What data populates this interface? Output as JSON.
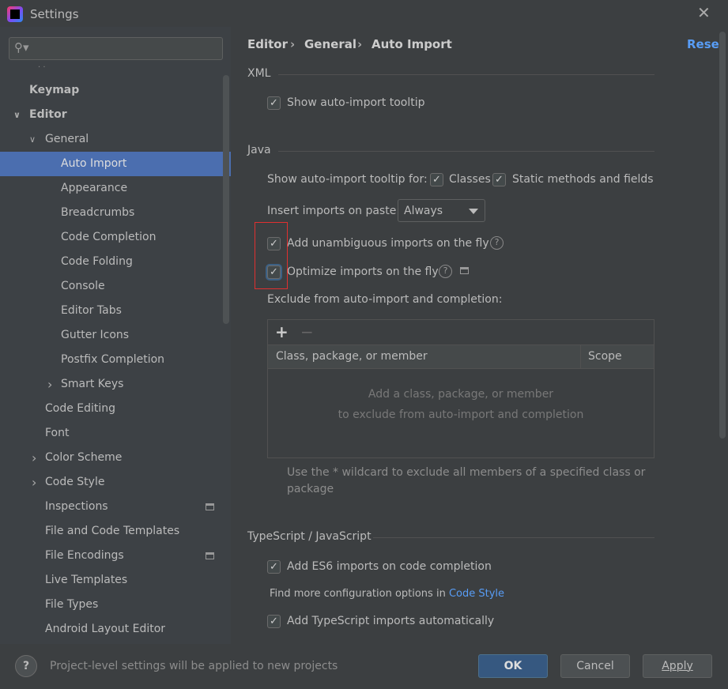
{
  "window": {
    "title": "Settings",
    "close": "✕"
  },
  "search": {
    "icon": "search-icon",
    "glyph": "⚲▾",
    "value": ""
  },
  "tree": [
    {
      "label": "Keymap",
      "level": 0,
      "bold": true
    },
    {
      "label": "Editor",
      "level": 0,
      "bold": true,
      "expanded": true
    },
    {
      "label": "General",
      "level": 1,
      "expanded": true
    },
    {
      "label": "Auto Import",
      "level": 2,
      "selected": true
    },
    {
      "label": "Appearance",
      "level": 2
    },
    {
      "label": "Breadcrumbs",
      "level": 2
    },
    {
      "label": "Code Completion",
      "level": 2
    },
    {
      "label": "Code Folding",
      "level": 2
    },
    {
      "label": "Console",
      "level": 2
    },
    {
      "label": "Editor Tabs",
      "level": 2
    },
    {
      "label": "Gutter Icons",
      "level": 2
    },
    {
      "label": "Postfix Completion",
      "level": 2
    },
    {
      "label": "Smart Keys",
      "level": 2,
      "collapsed": true
    },
    {
      "label": "Code Editing",
      "level": 1
    },
    {
      "label": "Font",
      "level": 1
    },
    {
      "label": "Color Scheme",
      "level": 1,
      "collapsed": true
    },
    {
      "label": "Code Style",
      "level": 1,
      "collapsed": true
    },
    {
      "label": "Inspections",
      "level": 1,
      "project": true
    },
    {
      "label": "File and Code Templates",
      "level": 1
    },
    {
      "label": "File Encodings",
      "level": 1,
      "project": true
    },
    {
      "label": "Live Templates",
      "level": 1
    },
    {
      "label": "File Types",
      "level": 1
    },
    {
      "label": "Android Layout Editor",
      "level": 1
    }
  ],
  "breadcrumb": [
    "Editor",
    "General",
    "Auto Import"
  ],
  "breadcrumb_sep": "›",
  "reset": "Reset",
  "xml": {
    "title": "XML",
    "show_tooltip": {
      "label": "Show auto-import tooltip",
      "checked": true
    }
  },
  "java": {
    "title": "Java",
    "tooltip_for": "Show auto-import tooltip for:",
    "classes": {
      "label": "Classes",
      "checked": true
    },
    "static": {
      "label": "Static methods and fields",
      "checked": true
    },
    "insert_label": "Insert imports on paste:",
    "insert_value": "Always",
    "unambiguous": {
      "label": "Add unambiguous imports on the fly",
      "checked": true
    },
    "optimize": {
      "label": "Optimize imports on the fly",
      "checked": true
    },
    "exclude_label": "Exclude from auto-import and completion:",
    "add": "+",
    "remove": "−",
    "columns": [
      "Class, package, or member",
      "Scope"
    ],
    "empty1": "Add a class, package, or member",
    "empty2": "to exclude from auto-import and completion",
    "hint1": "Use the * wildcard to exclude all members of a specified class or",
    "hint2": "package"
  },
  "ts": {
    "title": "TypeScript / JavaScript",
    "es6": {
      "label": "Add ES6 imports on code completion",
      "checked": true
    },
    "more": "Find more configuration options in",
    "more_link": "Code Style",
    "ts_auto": {
      "label": "Add TypeScript imports automatically",
      "checked": true
    }
  },
  "footer": {
    "help": "?",
    "note": "Project-level settings will be applied to new projects",
    "ok": "OK",
    "cancel": "Cancel",
    "apply": "Apply"
  },
  "colors": {
    "accent": "#4b6eaf",
    "link": "#589df6",
    "primary_button": "#365880",
    "highlight_box": "#e03030"
  },
  "check": "✓"
}
